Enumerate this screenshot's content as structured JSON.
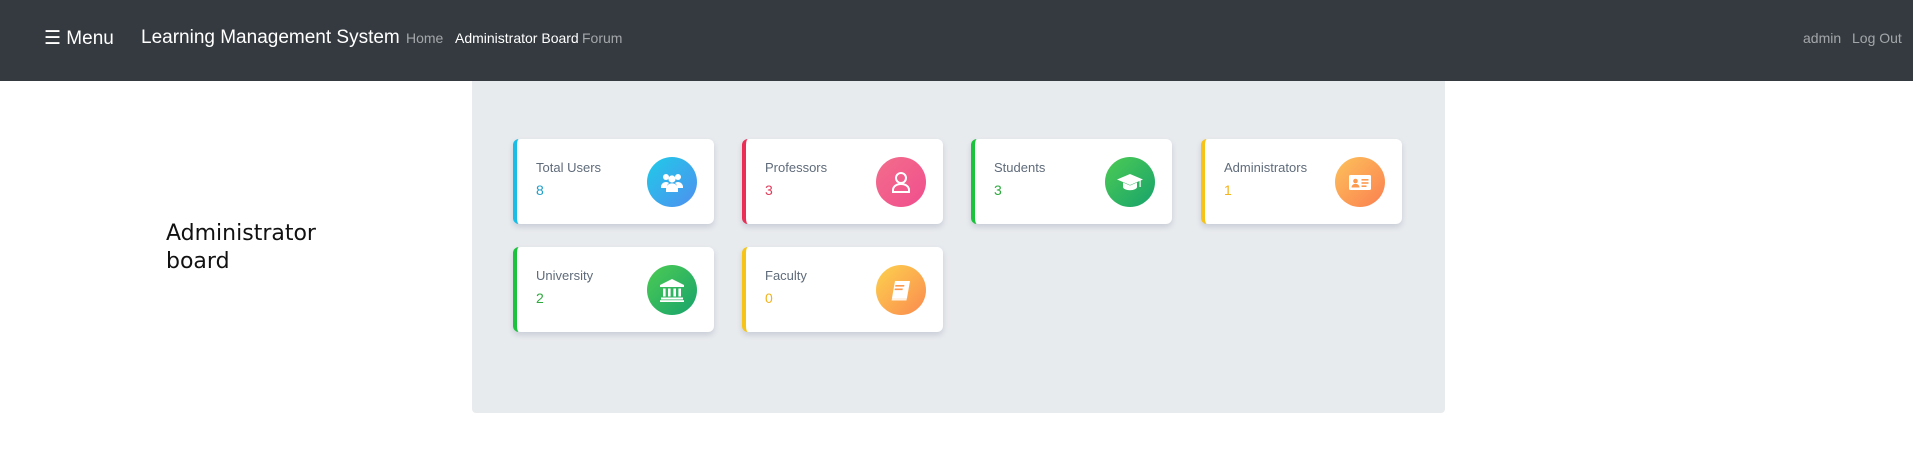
{
  "navbar": {
    "menu_label": "☰ Menu",
    "brand": "Learning Management System",
    "links": [
      {
        "label": "Home",
        "active": false
      },
      {
        "label": "Administrator Board",
        "active": true
      },
      {
        "label": "Forum",
        "active": false
      }
    ],
    "user": "admin",
    "logout": "Log Out"
  },
  "page": {
    "heading": "Administrator board"
  },
  "cards": [
    {
      "label": "Total Users",
      "value": "8",
      "icon": "users-icon",
      "accent": "#19bde6"
    },
    {
      "label": "Professors",
      "value": "3",
      "icon": "user-icon",
      "accent": "#ea2e56"
    },
    {
      "label": "Students",
      "value": "3",
      "icon": "graduation-cap-icon",
      "accent": "#1bc23b"
    },
    {
      "label": "Administrators",
      "value": "1",
      "icon": "id-card-icon",
      "accent": "#f6c319"
    },
    {
      "label": "University",
      "value": "2",
      "icon": "university-icon",
      "accent": "#1bc23b"
    },
    {
      "label": "Faculty",
      "value": "0",
      "icon": "book-icon",
      "accent": "#f6c319"
    }
  ]
}
